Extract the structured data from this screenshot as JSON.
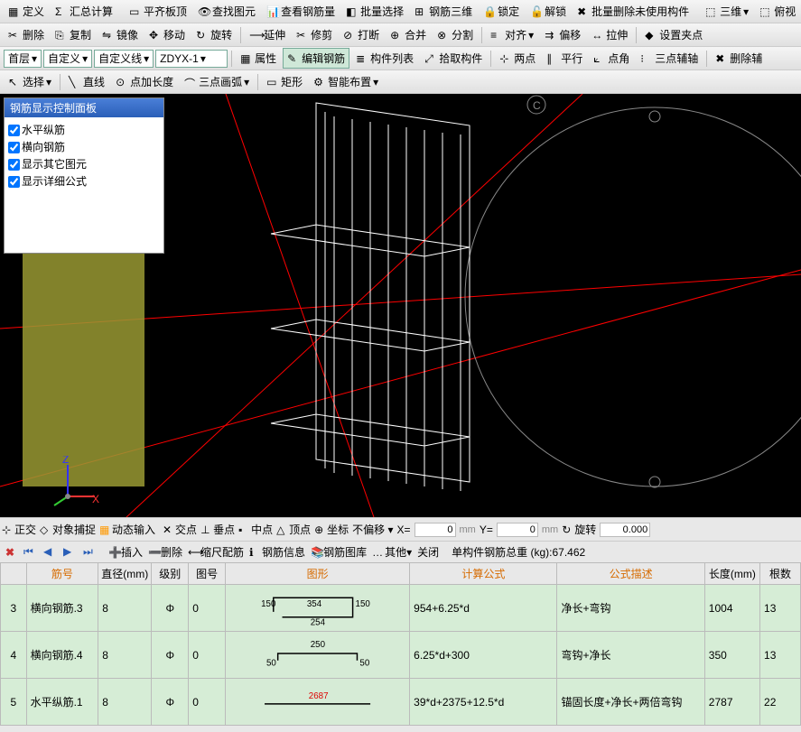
{
  "toolbar1": {
    "define": "定义",
    "summary_calc": "汇总计算",
    "balance_board": "平齐板顶",
    "find_element": "查找图元",
    "view_rebar": "查看钢筋量",
    "batch_select": "批量选择",
    "rebar_3d": "钢筋三维",
    "lock": "锁定",
    "unlock": "解锁",
    "batch_delete_unused": "批量删除未使用构件",
    "view_3d": "三维",
    "top_view": "俯视"
  },
  "toolbar2": {
    "delete": "删除",
    "copy": "复制",
    "mirror": "镜像",
    "move": "移动",
    "rotate": "旋转",
    "extend": "延伸",
    "trim": "修剪",
    "break": "打断",
    "merge": "合并",
    "split": "分割",
    "align": "对齐",
    "offset": "偏移",
    "stretch": "拉伸",
    "set_grip": "设置夹点"
  },
  "toolbar3": {
    "floor": "首层",
    "custom": "自定义",
    "custom_line": "自定义线",
    "code": "ZDYX-1",
    "properties": "属性",
    "edit_rebar": "编辑钢筋",
    "component_list": "构件列表",
    "pick_component": "拾取构件",
    "two_point": "两点",
    "parallel": "平行",
    "point_angle": "点角",
    "three_point_aux": "三点辅轴",
    "delete_aux": "删除辅"
  },
  "toolbar4": {
    "select": "选择",
    "line": "直线",
    "point_add_length": "点加长度",
    "three_point_arc": "三点画弧",
    "rect": "矩形",
    "smart_layout": "智能布置"
  },
  "panel": {
    "title": "钢筋显示控制面板",
    "items": [
      "水平纵筋",
      "横向钢筋",
      "显示其它图元",
      "显示详细公式"
    ]
  },
  "axis_labels": {
    "c": "C",
    "x": "X",
    "z": "Z"
  },
  "status": {
    "ortho": "正交",
    "osnap": "对象捕捉",
    "dyn_input": "动态输入",
    "intersection": "交点",
    "perp": "垂点",
    "mid": "中点",
    "vertex": "顶点",
    "coord": "坐标",
    "no_offset": "不偏移",
    "x_label": "X=",
    "x_val": "0",
    "y_label": "Y=",
    "y_val": "0",
    "unit": "mm",
    "rotate": "旋转",
    "rotate_val": "0.000"
  },
  "record": {
    "insert": "插入",
    "delete": "删除",
    "scale_rebar": "缩尺配筋",
    "rebar_info": "钢筋信息",
    "rebar_library": "钢筋图库",
    "other": "其他",
    "close": "关闭",
    "total_weight_label": "单构件钢筋总重 (kg):",
    "total_weight": "67.462"
  },
  "table": {
    "headers": {
      "num": "",
      "rebar_id": "筋号",
      "diameter": "直径(mm)",
      "grade": "级别",
      "drawing_id": "图号",
      "shape": "图形",
      "formula": "计算公式",
      "formula_desc": "公式描述",
      "length": "长度(mm)",
      "count": "根数"
    },
    "rows": [
      {
        "idx": "3",
        "rebar_id": "横向钢筋.3",
        "diameter": "8",
        "grade": "Φ",
        "drawing_id": "0",
        "shape": {
          "top_center": "354",
          "bottom": "254",
          "right": "150",
          "left": "150"
        },
        "formula": "954+6.25*d",
        "formula_desc": "净长+弯钩",
        "length": "1004",
        "count": "13"
      },
      {
        "idx": "4",
        "rebar_id": "横向钢筋.4",
        "diameter": "8",
        "grade": "Φ",
        "drawing_id": "0",
        "shape": {
          "top": "250",
          "left": "50",
          "right": "50"
        },
        "formula": "6.25*d+300",
        "formula_desc": "弯钩+净长",
        "length": "350",
        "count": "13"
      },
      {
        "idx": "5",
        "rebar_id": "水平纵筋.1",
        "diameter": "8",
        "grade": "Φ",
        "drawing_id": "0",
        "shape": {
          "center": "2687"
        },
        "formula": "39*d+2375+12.5*d",
        "formula_desc": "锚固长度+净长+两倍弯钩",
        "length": "2787",
        "count": "22"
      }
    ]
  }
}
